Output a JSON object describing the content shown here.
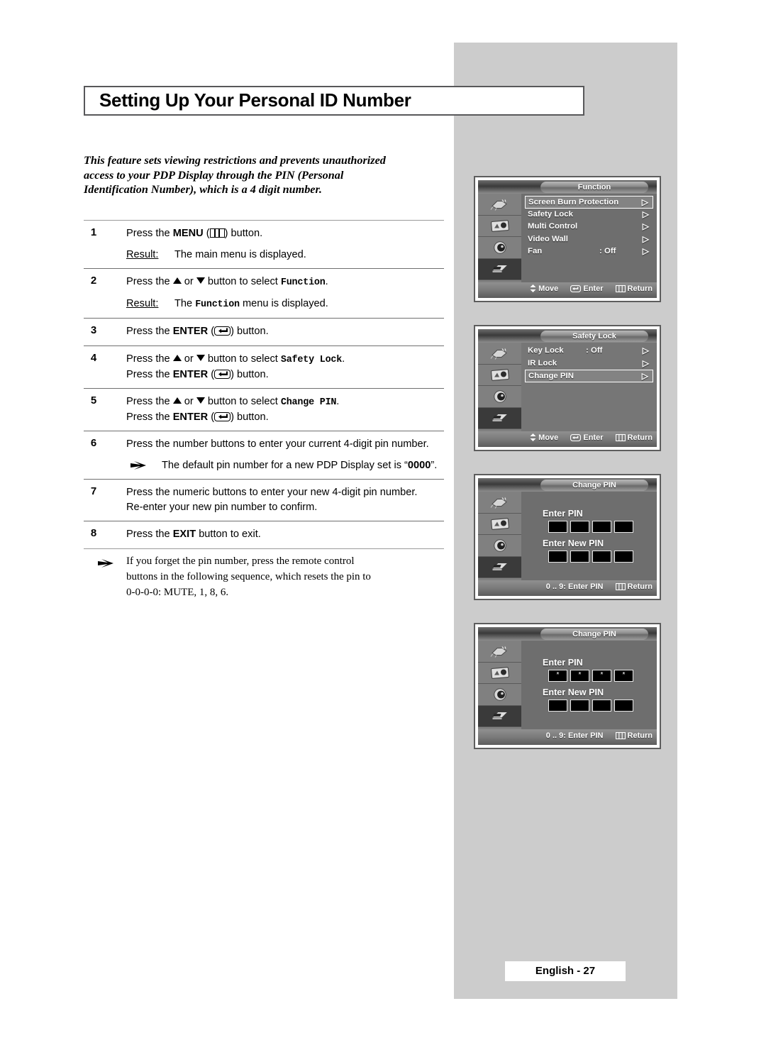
{
  "page": {
    "title": "Setting Up Your Personal ID Number",
    "footer": "English - 27"
  },
  "intro": {
    "line1": "This feature sets viewing restrictions and prevents unauthorized",
    "line2": "access to your PDP Display through the PIN (Personal",
    "line3": "Identification Number), which is a 4 digit number."
  },
  "steps": [
    {
      "num": "1",
      "pre": "Press the ",
      "key": "MENU",
      "mid": " (",
      "icon": "menu-icon",
      "post": ") button.",
      "result_label": "Result:",
      "result_text": "The main menu is displayed."
    },
    {
      "num": "2",
      "pre": "Press the ",
      "mid1": " or ",
      "mid2": " button to select ",
      "mono": "Function",
      "post": ".",
      "result_label": "Result:",
      "result_pre": "The ",
      "result_mono": "Function",
      "result_post": " menu is displayed."
    },
    {
      "num": "3",
      "pre": "Press the ",
      "key": "ENTER",
      "mid": " (",
      "icon": "enter-icon",
      "post": ") button."
    },
    {
      "num": "4",
      "line1_pre": "Press the ",
      "line1_mid1": " or ",
      "line1_mid2": " button to select ",
      "line1_mono": "Safety Lock",
      "line1_post": ".",
      "line2_pre": "Press the ",
      "line2_key": "ENTER",
      "line2_mid": " (",
      "line2_post": ") button."
    },
    {
      "num": "5",
      "line1_pre": "Press the ",
      "line1_mid1": " or ",
      "line1_mid2": " button to select ",
      "line1_mono": "Change PIN",
      "line1_post": ".",
      "line2_pre": "Press the ",
      "line2_key": "ENTER",
      "line2_mid": " (",
      "line2_post": ") button."
    },
    {
      "num": "6",
      "line1": "Press the number buttons to enter your current 4-digit pin number.",
      "bullet_pre": "The default pin number for a new PDP Display set is “",
      "bullet_bold": "0000",
      "bullet_post": "”."
    },
    {
      "num": "7",
      "line1": "Press the numeric buttons to enter your new 4-digit pin number.",
      "line2": "Re-enter your new pin number to confirm."
    },
    {
      "num": "8",
      "pre": "Press the ",
      "key": "EXIT",
      "post": " button to exit."
    }
  ],
  "final_note": {
    "line1": "If you forget the pin number, press the remote control",
    "line2": "buttons in the following sequence, which resets the pin to",
    "line3": "0-0-0-0: MUTE, 1, 8, 6."
  },
  "osd_hints": {
    "move": "Move",
    "enter": "Enter",
    "return": "Return",
    "pin_entry": "0 .. 9: Enter PIN"
  },
  "osd_screens": [
    {
      "name": "function-menu",
      "title": "Function",
      "rows": [
        {
          "label": "Screen Burn Protection",
          "value": "",
          "chevron": "▷",
          "highlighted": true
        },
        {
          "label": "Safety Lock",
          "value": "",
          "chevron": "▷",
          "highlighted": false
        },
        {
          "label": "Multi Control",
          "value": "",
          "chevron": "▷",
          "highlighted": false
        },
        {
          "label": "Video Wall",
          "value": "",
          "chevron": "▷",
          "highlighted": false
        },
        {
          "label": "Fan",
          "value": ": Off",
          "chevron": "▷",
          "highlighted": false
        }
      ],
      "footer_hints": [
        "Move",
        "Enter",
        "Return"
      ]
    },
    {
      "name": "safety-lock-menu",
      "title": "Safety Lock",
      "rows": [
        {
          "label": "Key Lock",
          "value": ": Off",
          "chevron": "▷",
          "highlighted": false
        },
        {
          "label": "IR Lock",
          "value": "",
          "chevron": "▷",
          "highlighted": false
        },
        {
          "label": "Change PIN",
          "value": "",
          "chevron": "▷",
          "highlighted": true
        }
      ],
      "footer_hints": [
        "Move",
        "Enter",
        "Return"
      ]
    },
    {
      "name": "change-pin-empty",
      "title": "Change PIN",
      "pin_sections": [
        {
          "label": "Enter PIN",
          "digits": [
            "",
            "",
            "",
            ""
          ]
        },
        {
          "label": "Enter New PIN",
          "digits": [
            "",
            "",
            "",
            ""
          ]
        }
      ],
      "footer_hints": [
        "0 .. 9: Enter PIN",
        "Return"
      ]
    },
    {
      "name": "change-pin-filled",
      "title": "Change PIN",
      "pin_sections": [
        {
          "label": "Enter PIN",
          "digits": [
            "*",
            "*",
            "*",
            "*"
          ]
        },
        {
          "label": "Enter New PIN",
          "digits": [
            "",
            "",
            "",
            ""
          ]
        }
      ],
      "footer_hints": [
        "0 .. 9: Enter PIN",
        "Return"
      ]
    }
  ],
  "osd_sidebar_icons": [
    "input-plug-icon",
    "picture-icon",
    "sound-speaker-icon",
    "function-icon",
    "setup-gear-icon"
  ],
  "colors": {
    "panel_grey": "#cccccc",
    "osd_body": "#6e6e6e",
    "osd_border": "#5d5d5d",
    "text": "#000000"
  }
}
